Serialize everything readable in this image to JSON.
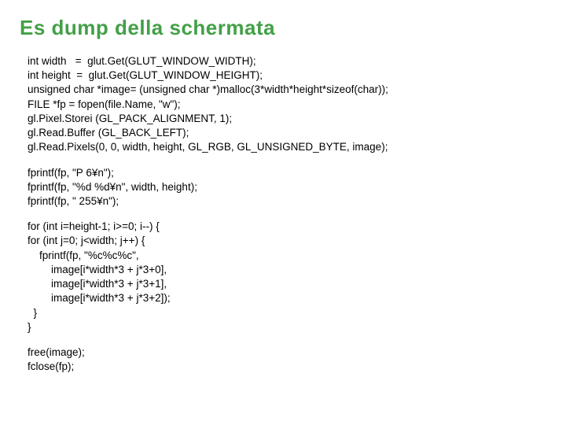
{
  "title": "Es dump della schermata",
  "code": {
    "block1": "int width   =  glut.Get(GLUT_WINDOW_WIDTH);\nint height  =  glut.Get(GLUT_WINDOW_HEIGHT);\nunsigned char *image= (unsigned char *)malloc(3*width*height*sizeof(char));\nFILE *fp = fopen(file.Name, \"w\");\ngl.Pixel.Storei (GL_PACK_ALIGNMENT, 1);\ngl.Read.Buffer (GL_BACK_LEFT);\ngl.Read.Pixels(0, 0, width, height, GL_RGB, GL_UNSIGNED_BYTE, image);",
    "block2": "fprintf(fp, \"P 6¥n\");\nfprintf(fp, \"%d %d¥n\", width, height);\nfprintf(fp, \" 255¥n\");",
    "block3": "for (int i=height-1; i>=0; i--) {\nfor (int j=0; j<width; j++) {\n    fprintf(fp, \"%c%c%c\",\n        image[i*width*3 + j*3+0],\n        image[i*width*3 + j*3+1],\n        image[i*width*3 + j*3+2]);\n  }\n}",
    "block4": "free(image);\nfclose(fp);"
  }
}
